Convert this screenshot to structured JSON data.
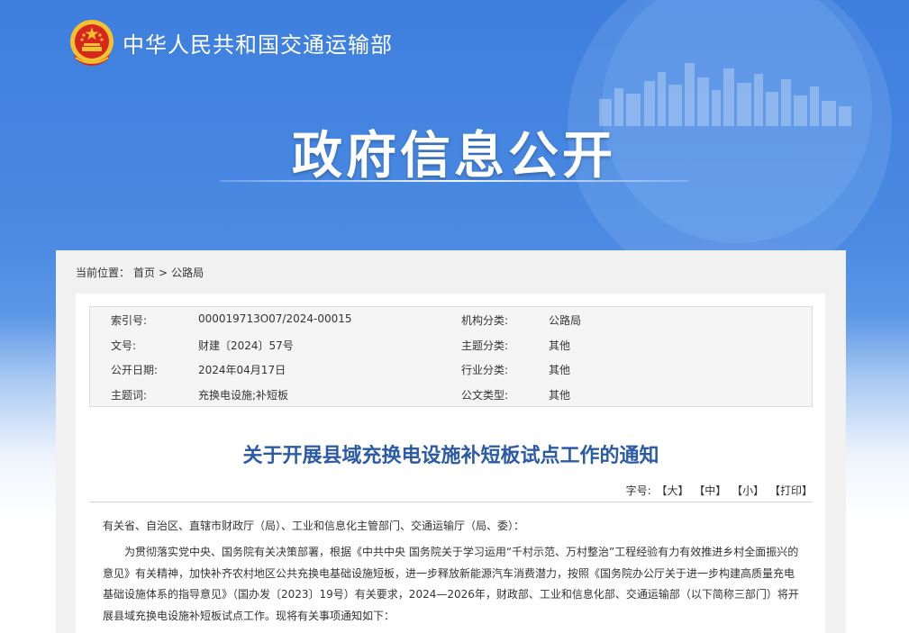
{
  "header": {
    "ministry_name": "中华人民共和国交通运输部",
    "hero_title": "政府信息公开"
  },
  "breadcrumb": {
    "prefix": "当前位置：",
    "items": [
      "首页",
      "公路局"
    ],
    "separator": ">"
  },
  "meta": {
    "rows": [
      {
        "k1": "索引号:",
        "v1": "000019713O07/2024-00015",
        "k2": "机构分类:",
        "v2": "公路局"
      },
      {
        "k1": "文号:",
        "v1": "财建〔2024〕57号",
        "k2": "主题分类:",
        "v2": "其他"
      },
      {
        "k1": "公开日期:",
        "v1": "2024年04月17日",
        "k2": "行业分类:",
        "v2": "其他"
      },
      {
        "k1": "主题词:",
        "v1": "充换电设施;补短板",
        "k2": "公文类型:",
        "v2": "其他"
      }
    ]
  },
  "document": {
    "title": "关于开展县域充换电设施补短板试点工作的通知",
    "salutation": "有关省、自治区、直辖市财政厅（局）、工业和信息化主管部门、交通运输厅（局、委）：",
    "paragraph1": "为贯彻落实党中央、国务院有关决策部署，根据《中共中央 国务院关于学习运用“千村示范、万村整治”工程经验有力有效推进乡村全面振兴的意见》有关精神，加快补齐农村地区公共充换电基础设施短板，进一步释放新能源汽车消费潜力，按照《国务院办公厅关于进一步构建高质量充电基础设施体系的指导意见》（国办发〔2023〕19号）有关要求，2024—2026年，财政部、工业和信息化部、交通运输部（以下简称三部门）将开展县域充换电设施补短板试点工作。现将有关事项通知如下："
  },
  "fontsize": {
    "label": "字号:",
    "large": "【大】",
    "medium": "【中】",
    "small": "【小】",
    "print": "【打印】"
  },
  "colors": {
    "banner_blue": "#3e7fde",
    "title_blue": "#2b5aa6",
    "emblem_red": "#d7261e",
    "emblem_gold": "#f2c230"
  },
  "icons": {
    "emblem": "national-emblem-icon",
    "skyline": "city-skyline-decoration"
  }
}
